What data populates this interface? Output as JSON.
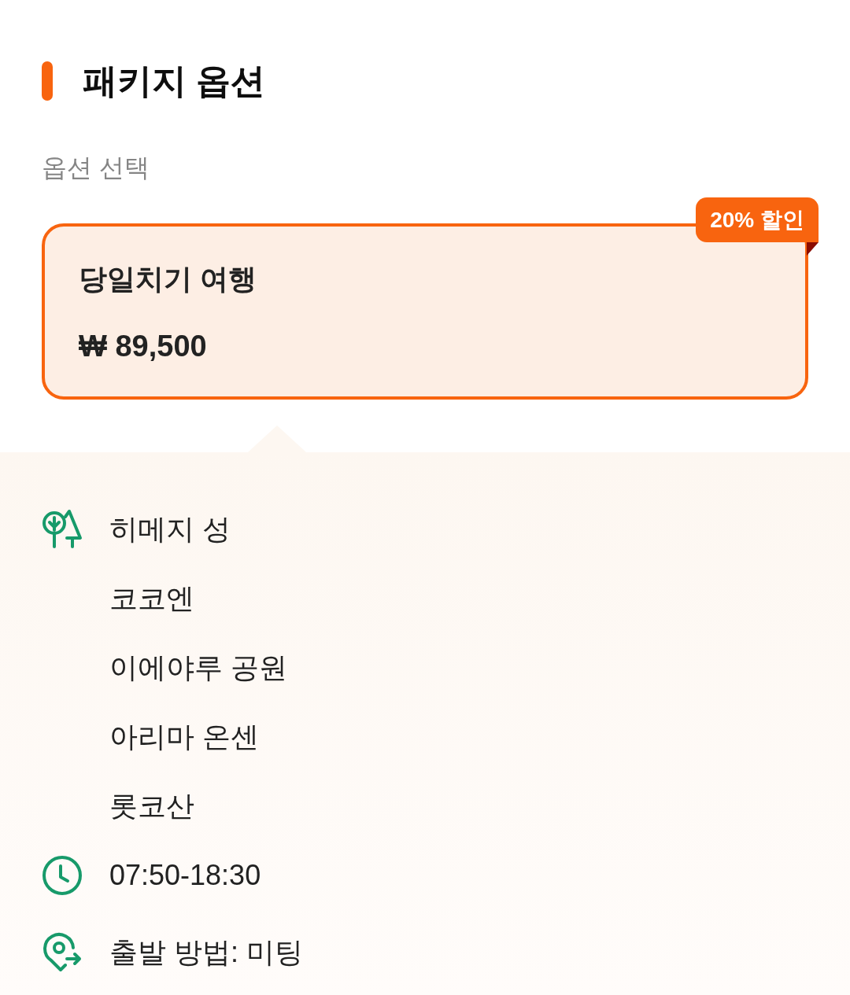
{
  "section": {
    "title": "패키지 옵션",
    "subtitle": "옵션 선택"
  },
  "options": [
    {
      "name": "당일치기 여행",
      "price": "₩ 89,500",
      "badge": "20% 할인",
      "selected": true
    }
  ],
  "details": [
    {
      "kind": "places",
      "items": [
        "히메지 성",
        "코코엔",
        "이에야루 공원",
        "아리마 온센",
        "롯코산"
      ]
    },
    {
      "kind": "time",
      "text": "07:50-18:30"
    },
    {
      "kind": "departure",
      "text": "출발 방법: 미팅"
    }
  ]
}
